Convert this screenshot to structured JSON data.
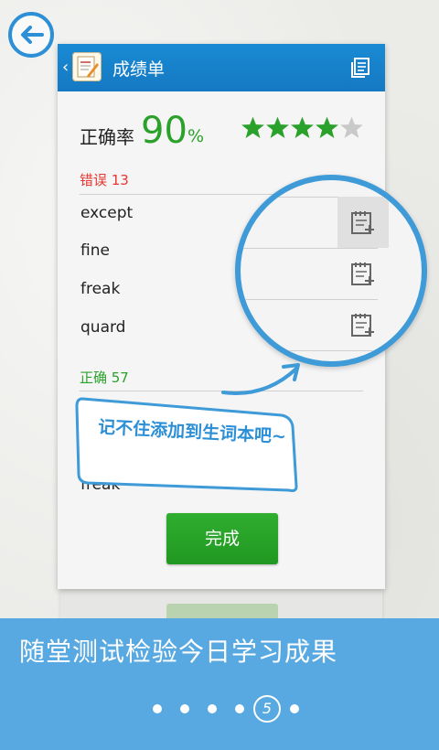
{
  "header": {
    "title": "成绩单"
  },
  "score": {
    "label": "正确率",
    "value": "90",
    "unit": "%",
    "stars_filled": 4,
    "stars_total": 5
  },
  "wrong_section": {
    "label": "错误 13",
    "words": [
      "except",
      "fine",
      "freak",
      "quard"
    ]
  },
  "right_section": {
    "label": "正确 57",
    "words": [
      "freak"
    ]
  },
  "tip": {
    "text": "记不住添加到生词本吧~"
  },
  "done_button": {
    "label": "完成"
  },
  "banner": {
    "title": "随堂测试检验今日学习成果"
  },
  "pager": {
    "current": "5"
  },
  "icons": {
    "back": "back-arrow-icon",
    "copy": "copy-icon",
    "add_notebook": "add-to-notebook-icon",
    "star": "star-icon"
  },
  "colors": {
    "accent_blue": "#1a8ad4",
    "green": "#2aa12a",
    "error_red": "#e5362f",
    "banner_blue": "#58a9e1"
  }
}
